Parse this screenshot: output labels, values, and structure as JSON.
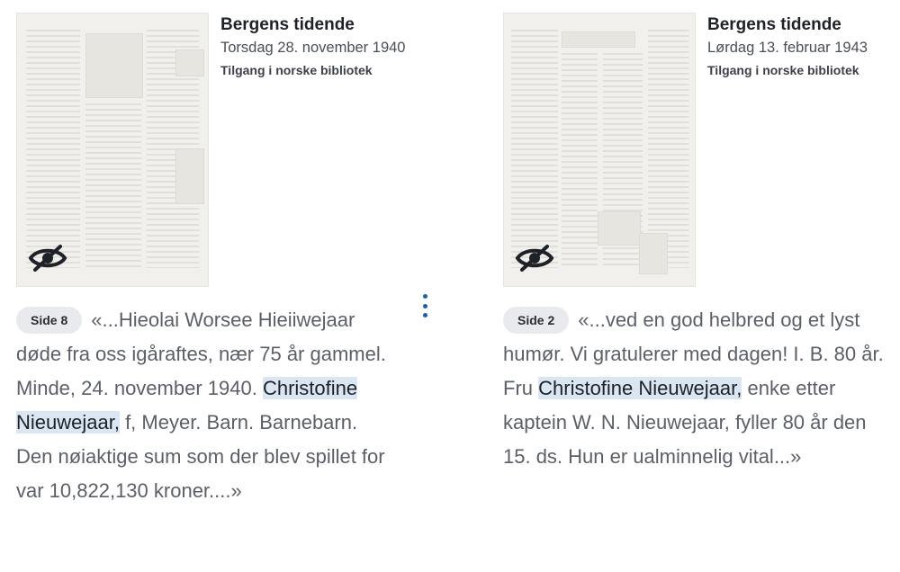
{
  "results": [
    {
      "title": "Bergens tidende",
      "date": "Torsdag 28. november 1940",
      "access": "Tilgang i norske bibliotek",
      "page_badge": "Side 8",
      "snippet_before": "«...Hieolai Worsee Hieiiwejaar døde fra oss igåraftes, nær 75 år gammel. Minde, 24. november 1940. ",
      "snippet_highlight": "Christofine Nieuwejaar,",
      "snippet_after": " f, Meyer. Barn. Barnebarn. Den nøiaktige sum som der blev spillet for var 10,822,130 kroner....»",
      "thumbnail_icon": "eye-off-icon"
    },
    {
      "title": "Bergens tidende",
      "date": "Lørdag 13. februar 1943",
      "access": "Tilgang i norske bibliotek",
      "page_badge": "Side 2",
      "snippet_before": "«...ved en god helbred og et lyst humør. Vi gratulerer med dagen! I. B. 80 år. Fru ",
      "snippet_highlight": "Christofine Nieuwejaar,",
      "snippet_after": " enke etter kaptein W. N. Nieuwejaar, fyller 80 år den 15. ds. Hun er ualminnelig vital...»",
      "thumbnail_icon": "eye-off-icon"
    }
  ],
  "menu_icon": "more-vertical-icon",
  "colors": {
    "highlight": "#dbe6f3",
    "badge_bg": "#e8eaee",
    "accent": "#1f5ea8"
  }
}
